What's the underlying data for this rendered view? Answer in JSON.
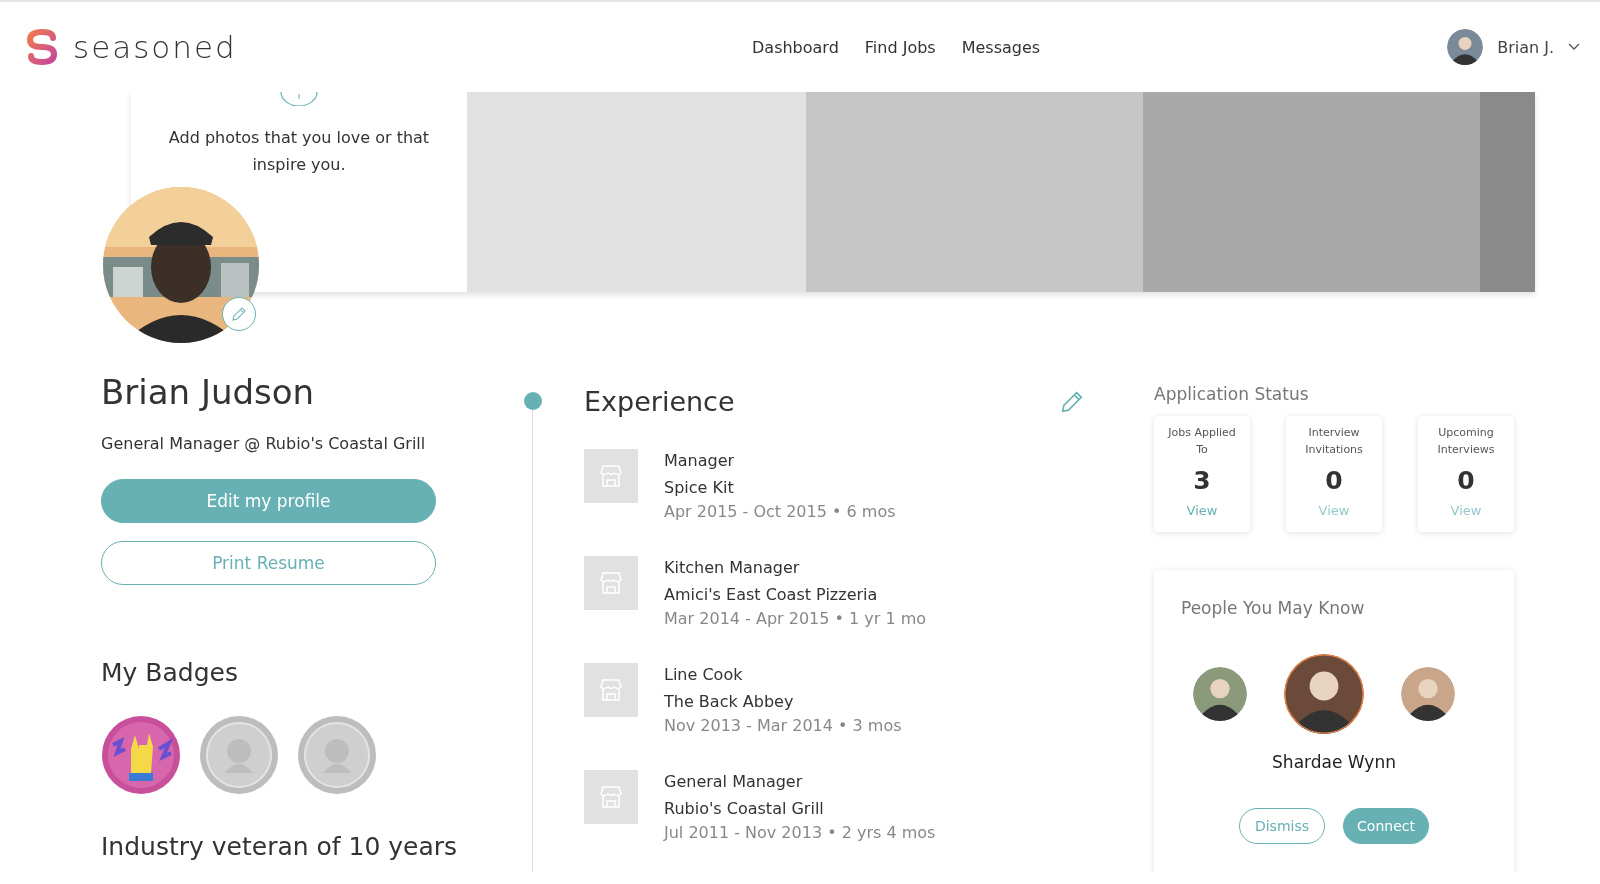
{
  "header": {
    "logo": "seasoned",
    "nav": [
      {
        "label": "Dashboard",
        "selected": false
      },
      {
        "label": "Find Jobs",
        "selected": false
      },
      {
        "label": "Messages",
        "selected": false
      }
    ],
    "user": "Brian J."
  },
  "banner": {
    "prompt": "Add photos that you love or that inspire you."
  },
  "profile": {
    "name": "Brian Judson",
    "headline": "General Manager @ Rubio's Coastal Grill",
    "buttons": [
      {
        "label": "Edit my profile",
        "kind": "primary"
      },
      {
        "label": "Print Resume",
        "kind": "outline"
      }
    ],
    "badges_title": "My Badges",
    "badges": [
      {
        "earned": true
      },
      {
        "earned": false
      },
      {
        "earned": false
      }
    ],
    "summary_title": "Industry veteran of 10 years"
  },
  "experience": {
    "title": "Experience",
    "separator": "•",
    "items": [
      {
        "role": "Manager",
        "company": "Spice Kit",
        "dates": "Apr 2015 - Oct 2015",
        "duration": "6 mos"
      },
      {
        "role": "Kitchen Manager",
        "company": "Amici's East Coast Pizzeria",
        "dates": "Mar 2014 - Apr 2015",
        "duration": "1 yr 1 mo"
      },
      {
        "role": "Line Cook",
        "company": "The Back Abbey",
        "dates": "Nov 2013 - Mar 2014",
        "duration": "3 mos"
      },
      {
        "role": "General Manager",
        "company": "Rubio's Coastal Grill",
        "dates": "Jul 2011 - Nov 2013",
        "duration": "2 yrs 4 mos"
      }
    ]
  },
  "application_status": {
    "title": "Application Status",
    "cards": [
      {
        "label": "Jobs Applied To",
        "count": "3",
        "link": "View",
        "disabled": false
      },
      {
        "label": "Interview Invitations",
        "count": "0",
        "link": "View",
        "disabled": true
      },
      {
        "label": "Upcoming Interviews",
        "count": "0",
        "link": "View",
        "disabled": true
      }
    ]
  },
  "people": {
    "title": "People You May Know",
    "people": [
      {
        "selected": false,
        "color": "#8a9a7a"
      },
      {
        "selected": true,
        "color": "#6b4a3a"
      },
      {
        "selected": false,
        "color": "#c9a58a"
      }
    ],
    "name": "Shardae Wynn",
    "buttons": [
      {
        "label": "Dismiss",
        "kind": "outline"
      },
      {
        "label": "Connect",
        "kind": "primary"
      }
    ]
  }
}
